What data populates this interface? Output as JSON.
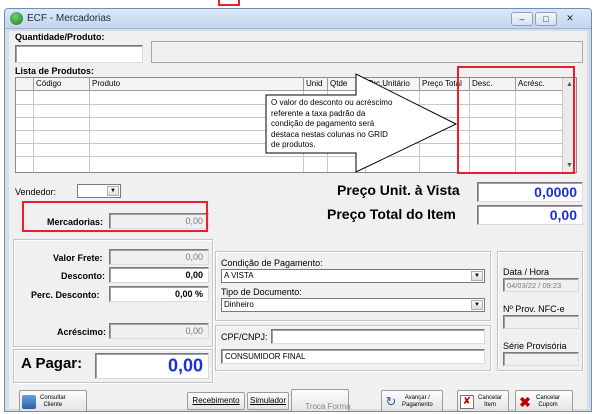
{
  "window": {
    "title": "ECF - Mercadorias",
    "controls": [
      "–",
      "□",
      "✕"
    ]
  },
  "quantidade": {
    "label": "Quantidade/Produto:"
  },
  "lista": {
    "label": "Lista de Produtos:",
    "columns": [
      "Código",
      "Produto",
      "Unid",
      "Qtde",
      "Prc.Unitário",
      "Preço Total",
      "Desc.",
      "Acrésc."
    ]
  },
  "callout": {
    "text": "O valor do desconto ou acréscimo referente a taxa padrão da condição de pagamento será destaca nestas colunas no GRID de produtos."
  },
  "vendedor": {
    "label": "Vendedor:"
  },
  "preco_unit": {
    "label": "Preço Unit. à Vista",
    "value": "0,0000"
  },
  "preco_total": {
    "label": "Preço Total do Item",
    "value": "0,00"
  },
  "mercadorias": {
    "label": "Mercadorias:",
    "value": "0,00"
  },
  "totais": {
    "valor_frete": {
      "label": "Valor Frete:",
      "value": "0,00"
    },
    "desconto": {
      "label": "Desconto:",
      "value": "0,00"
    },
    "perc_desconto": {
      "label": "Perc. Desconto:",
      "value": "0,00 %"
    },
    "acrescimo": {
      "label": "Acréscimo:",
      "value": "0,00"
    }
  },
  "a_pagar": {
    "label": "A Pagar:",
    "value": "0,00"
  },
  "pagamento": {
    "condicao_label": "Condição de Pagamento:",
    "condicao_value": "A VISTA",
    "tipo_label": "Tipo de Documento:",
    "tipo_value": "Dinheiro",
    "cpf_label": "CPF/CNPJ:",
    "cliente_value": "CONSUMIDOR FINAL"
  },
  "info": {
    "data_label": "Data / Hora",
    "data_value": "04/03/22 / 09:23",
    "nprov_label": "Nº Prov. NFC-e",
    "serie_label": "Série Provisória"
  },
  "toolbar": {
    "consultar_cliente": "Consultar\nCliente",
    "recebimento": "Recebimento",
    "simulador": "Simulador",
    "troca_forma": "Troca Forma\nPagamento",
    "avancar": "Avançar /\nPagamento",
    "cancelar_item": "Cancelar\nItem",
    "cancelar_cupom": "Cancelar\nCupom"
  },
  "colors": {
    "accent_blue": "#1a2fd6",
    "highlight_red": "#e8202a"
  }
}
